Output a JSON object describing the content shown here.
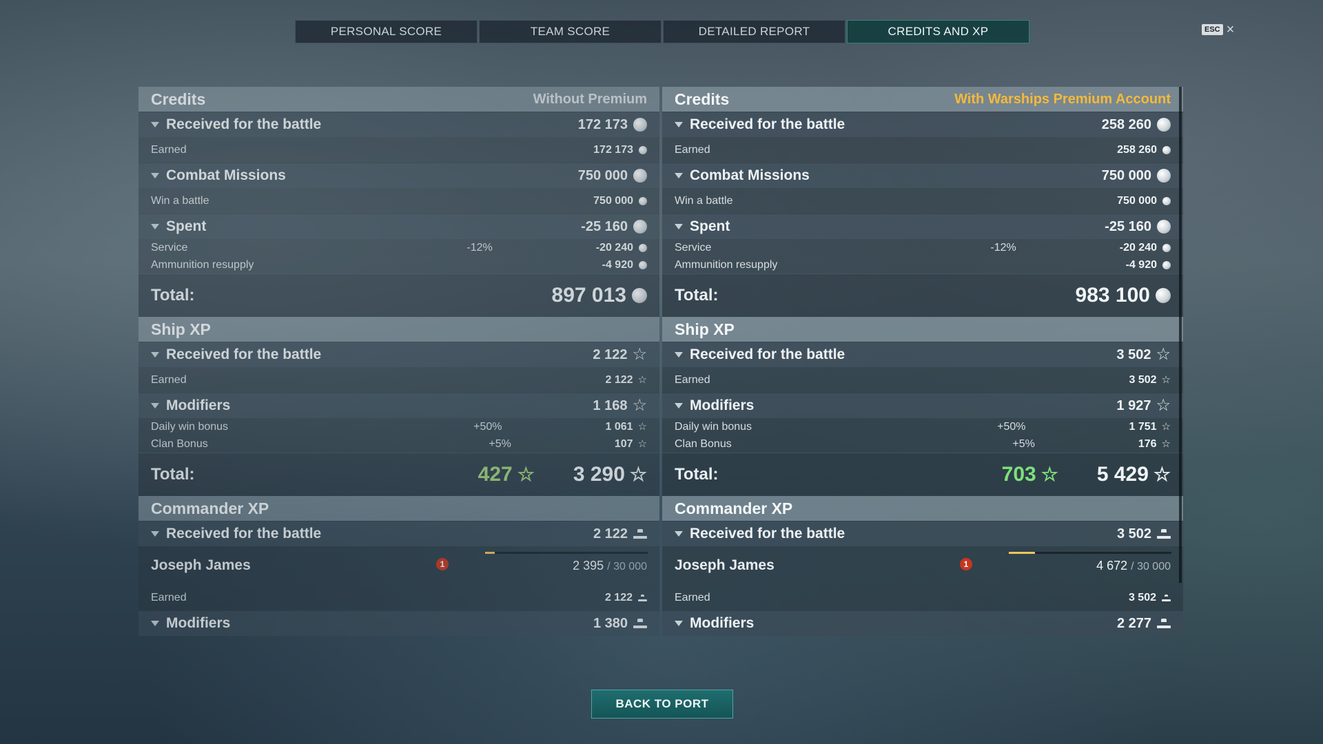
{
  "tabs": [
    "PERSONAL SCORE",
    "TEAM SCORE",
    "DETAILED REPORT",
    "CREDITS AND XP"
  ],
  "esc": {
    "key": "ESC",
    "close": "×"
  },
  "back_label": "BACK TO PORT",
  "left": {
    "credits_title": "Credits",
    "credits_subtitle": "Without Premium",
    "received_label": "Received for the battle",
    "received_value": "172 173",
    "earned_label": "Earned",
    "earned_value": "172 173",
    "missions_label": "Combat Missions",
    "missions_value": "750 000",
    "win_label": "Win a battle",
    "win_value": "750 000",
    "spent_label": "Spent",
    "spent_value": "-25 160",
    "service_label": "Service",
    "service_pct": "-12%",
    "service_value": "-20 240",
    "ammo_label": "Ammunition resupply",
    "ammo_value": "-4 920",
    "total_label": "Total:",
    "credits_total": "897 013",
    "shipxp_title": "Ship XP",
    "xp_received_value": "2 122",
    "xp_earned_value": "2 122",
    "modifiers_label": "Modifiers",
    "modifiers_value": "1 168",
    "daily_label": "Daily win bonus",
    "daily_pct": "+50%",
    "daily_value": "1 061",
    "clan_label": "Clan Bonus",
    "clan_pct": "+5%",
    "clan_value": "107",
    "xp_free": "427",
    "xp_total": "3 290",
    "cmdxp_title": "Commander XP",
    "cmd_received_value": "2 122",
    "commander_name": "Joseph James",
    "badge": "1",
    "cmd_xp": "2 395",
    "cmd_xp_max": "/ 30 000",
    "cmd_progress": 0.06,
    "cmd_earned_value": "2 122",
    "cmd_modifiers_value": "1 380"
  },
  "right": {
    "credits_title": "Credits",
    "credits_subtitle": "With Warships Premium Account",
    "received_label": "Received for the battle",
    "received_value": "258 260",
    "earned_label": "Earned",
    "earned_value": "258 260",
    "missions_label": "Combat Missions",
    "missions_value": "750 000",
    "win_label": "Win a battle",
    "win_value": "750 000",
    "spent_label": "Spent",
    "spent_value": "-25 160",
    "service_label": "Service",
    "service_pct": "-12%",
    "service_value": "-20 240",
    "ammo_label": "Ammunition resupply",
    "ammo_value": "-4 920",
    "total_label": "Total:",
    "credits_total": "983 100",
    "shipxp_title": "Ship XP",
    "xp_received_value": "3 502",
    "xp_earned_value": "3 502",
    "modifiers_label": "Modifiers",
    "modifiers_value": "1 927",
    "daily_label": "Daily win bonus",
    "daily_pct": "+50%",
    "daily_value": "1 751",
    "clan_label": "Clan Bonus",
    "clan_pct": "+5%",
    "clan_value": "176",
    "xp_free": "703",
    "xp_total": "5 429",
    "cmdxp_title": "Commander XP",
    "cmd_received_value": "3 502",
    "commander_name": "Joseph James",
    "badge": "1",
    "cmd_xp": "4 672",
    "cmd_xp_max": "/ 30 000",
    "cmd_progress": 0.16,
    "cmd_earned_value": "3 502",
    "cmd_modifiers_value": "2 277"
  },
  "colors": {
    "premium_gold": "#f5b93a",
    "free_xp_green": "#7ee07a",
    "active_tab": "#0f3c3c",
    "back_button": "#1f6d6f"
  },
  "icons": [
    "credits-icon",
    "xp-star-icon",
    "commander-xp-icon",
    "chevron-down-icon",
    "close-icon"
  ]
}
